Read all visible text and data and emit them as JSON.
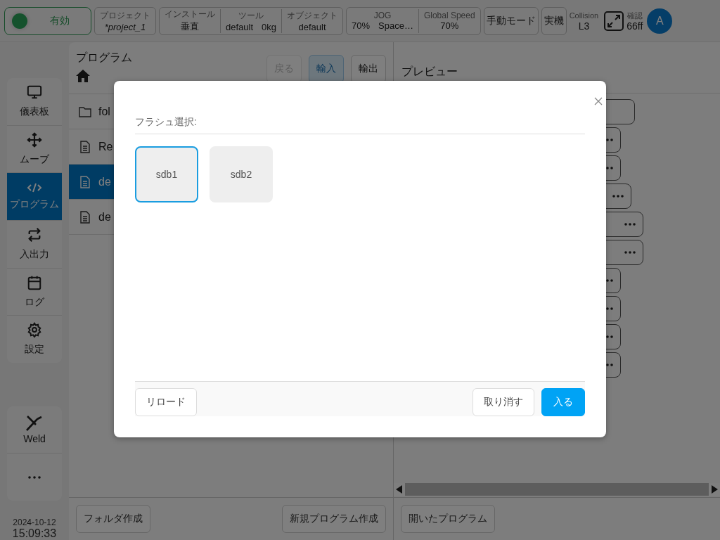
{
  "top_bar": {
    "status": {
      "label": "有効",
      "active": true
    },
    "groups": [
      {
        "fields": [
          {
            "label": "プロジェクト",
            "values": [
              "*project_1"
            ]
          }
        ]
      },
      {
        "fields": [
          {
            "label": "インストール",
            "values": [
              "垂直"
            ]
          },
          {
            "label": "ツール",
            "values": [
              "default",
              "0kg"
            ]
          },
          {
            "label": "オブジェクト",
            "values": [
              "default"
            ]
          }
        ]
      },
      {
        "fields": [
          {
            "label": "JOG",
            "values": [
              "70%",
              "Space…"
            ]
          },
          {
            "label": "Global Speed",
            "values": [
              "70%"
            ]
          }
        ]
      }
    ],
    "buttons": [
      "手動モード",
      "実機"
    ],
    "collision": {
      "label": "Collision",
      "value": "L3"
    },
    "confirm": {
      "label": "確認",
      "value": "66ff"
    },
    "avatar": "A"
  },
  "nav": {
    "items": [
      {
        "label": "儀表板",
        "selected": false
      },
      {
        "label": "ムーブ",
        "selected": false
      },
      {
        "label": "プログラム",
        "selected": true
      },
      {
        "label": "入出力",
        "selected": false
      },
      {
        "label": "ログ",
        "selected": false
      },
      {
        "label": "設定",
        "selected": false
      }
    ],
    "extra": [
      {
        "kind": "weld",
        "label": "Weld"
      },
      {
        "kind": "more"
      }
    ],
    "date": "2024-10-12",
    "time": "15:09:33"
  },
  "program": {
    "title": "プログラム",
    "buttons": [
      {
        "label": "戻る",
        "disabled": true,
        "selected": false
      },
      {
        "label": "輸入",
        "disabled": false,
        "selected": true
      },
      {
        "label": "輸出",
        "disabled": false,
        "selected": false
      }
    ],
    "files": [
      {
        "kind": "folder",
        "name": "fol",
        "selected": false
      },
      {
        "kind": "file",
        "name": "Re",
        "selected": false
      },
      {
        "kind": "file",
        "name": "de",
        "selected": true
      },
      {
        "kind": "file",
        "name": "de",
        "selected": false
      }
    ],
    "bottom_buttons": [
      "フォルダ作成",
      "新規プログラム作成"
    ]
  },
  "preview": {
    "title": "プレビュー",
    "nodes": [
      {
        "kind": "plain"
      },
      {
        "kind": "menu"
      },
      {
        "kind": "menu"
      },
      {
        "kind": "menu"
      },
      {
        "kind": "menu"
      },
      {
        "kind": "menu"
      },
      {
        "kind": "menu"
      },
      {
        "kind": "menu"
      },
      {
        "kind": "menu"
      },
      {
        "kind": "menu"
      }
    ],
    "bottom_buttons": [
      "開いたプログラム"
    ]
  },
  "modal": {
    "title": "フラシュ選択:",
    "options": [
      {
        "label": "sdb1",
        "selected": true
      },
      {
        "label": "sdb2",
        "selected": false
      }
    ],
    "reload": "リロード",
    "buttons": [
      {
        "label": "取り消す",
        "kind": "secondary"
      },
      {
        "label": "入る",
        "kind": "primary"
      }
    ]
  }
}
